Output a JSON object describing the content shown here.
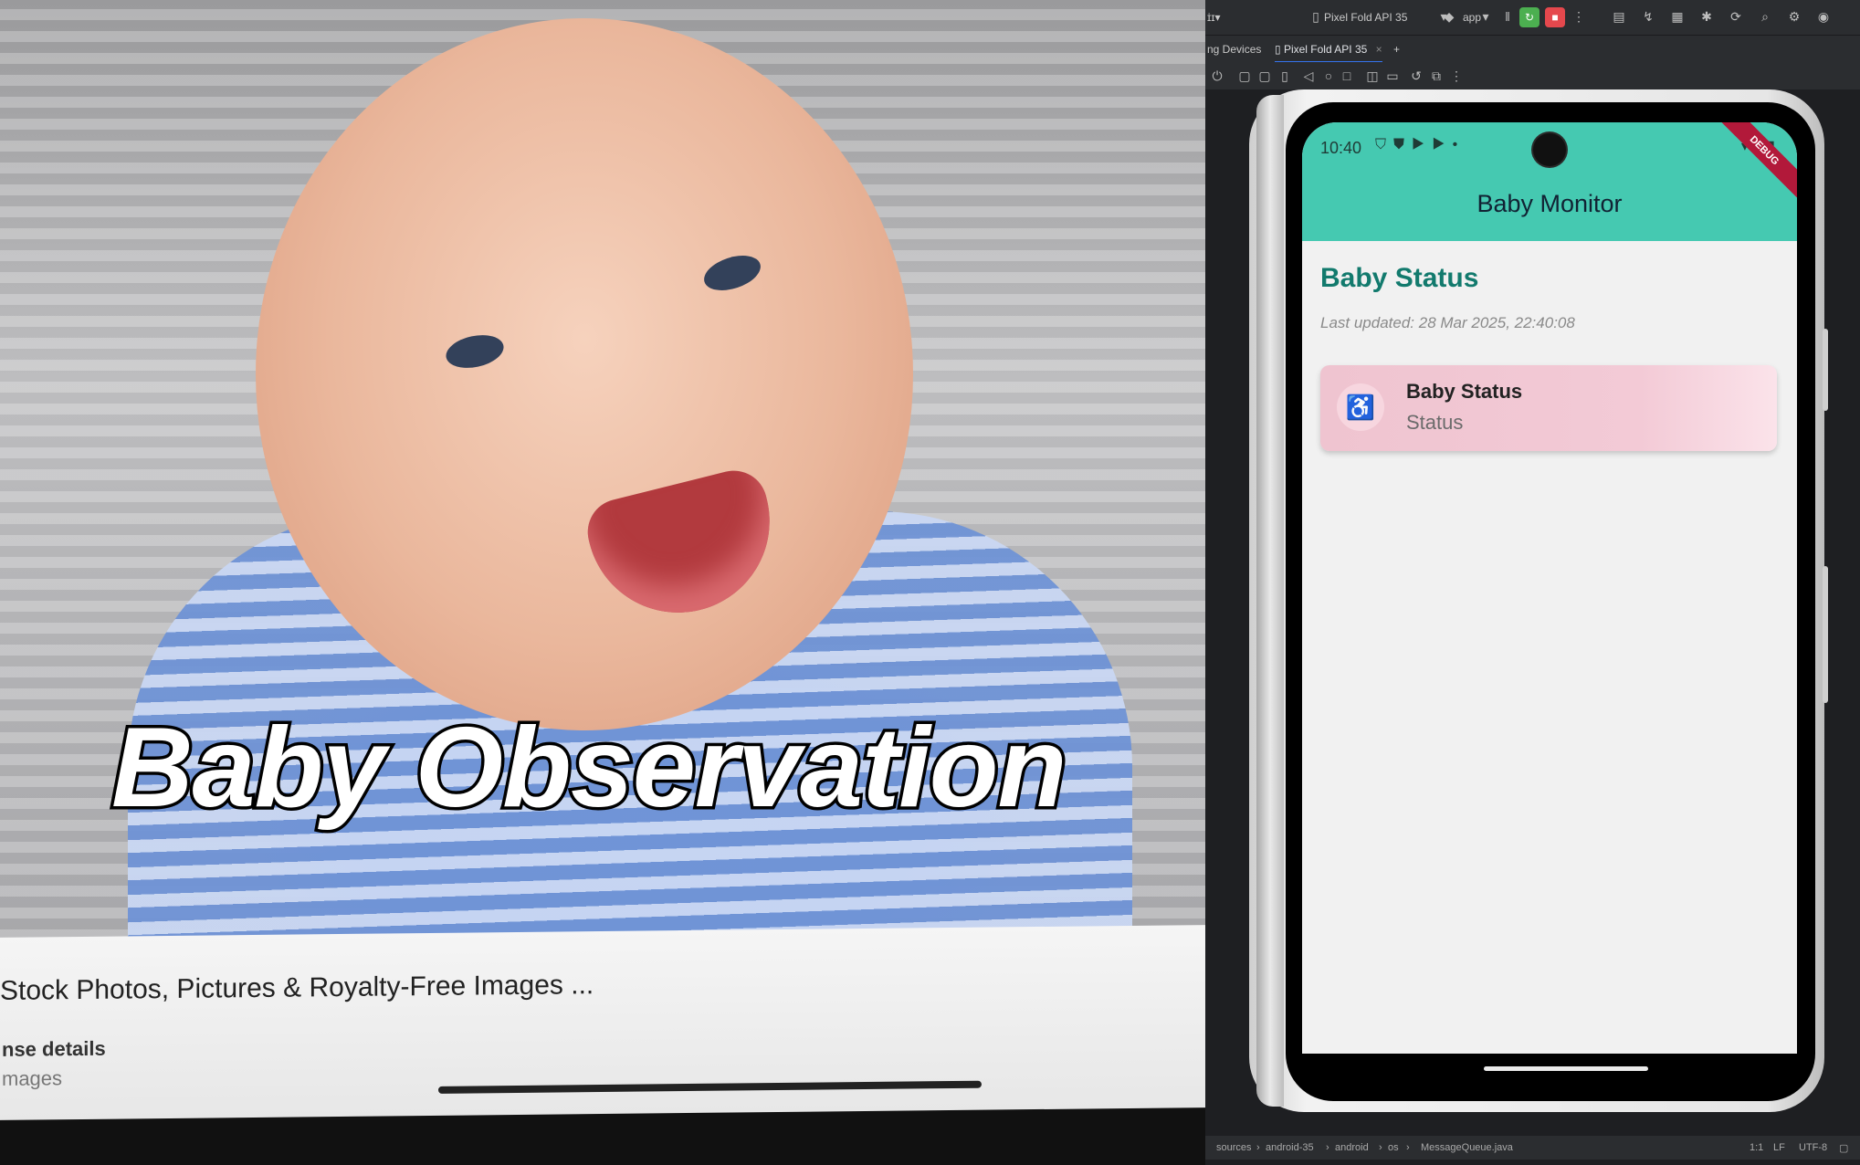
{
  "video_panel": {
    "overlay_title": "Baby Observation",
    "image_result_title": "Stock Photos, Pictures & Royalty-Free Images ...",
    "license_label": "nse details",
    "source_label": "mages"
  },
  "ide": {
    "toolbar": {
      "left_text": "ɪ̇ɪ▾",
      "device_selector": "Pixel Fold API 35",
      "module_selector": "app"
    },
    "tabs": {
      "running_devices": "ng Devices",
      "device_tab": "Pixel Fold API 35",
      "add_tab": "+"
    },
    "statusbar": {
      "breadcrumb_1": "sources",
      "breadcrumb_2": "android-35",
      "breadcrumb_3": "android",
      "breadcrumb_4": "os",
      "breadcrumb_5": "MessageQueue.java",
      "position": "1:1",
      "line_ending": "LF",
      "encoding": "UTF-8"
    }
  },
  "emulator": {
    "status_time": "10:40",
    "debug_banner": "DEBUG",
    "app": {
      "title": "Baby Monitor",
      "section_title": "Baby Status",
      "last_updated": "Last updated: 28 Mar 2025, 22:40:08",
      "card": {
        "title": "Baby Status",
        "subtitle": "Status",
        "icon": "baby-changing-icon"
      }
    }
  },
  "colors": {
    "app_bar": "#45c9b1",
    "section_title": "#127a6d",
    "card_gradient_start": "#efc4d0",
    "card_icon": "#e2467a",
    "run_button": "#4caf50",
    "stop_button": "#e5484d"
  }
}
